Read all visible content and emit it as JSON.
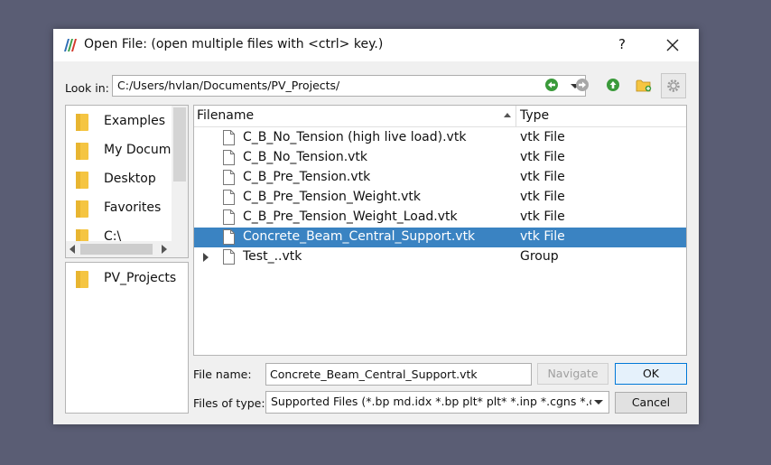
{
  "window": {
    "title": "Open File:  (open multiple files with <ctrl> key.)",
    "help_label": "?",
    "close_icon": "close-icon"
  },
  "look_in": {
    "label": "Look in:",
    "value": "C:/Users/hvlan/Documents/PV_Projects/"
  },
  "nav_icons": [
    "back-arrow-icon",
    "forward-arrow-icon",
    "up-arrow-icon",
    "new-folder-icon",
    "settings-gear-icon"
  ],
  "sidebar": {
    "favorites": [
      {
        "label": "Examples"
      },
      {
        "label": "My Docume"
      },
      {
        "label": "Desktop"
      },
      {
        "label": "Favorites"
      },
      {
        "label": "C:\\"
      }
    ],
    "recent": [
      {
        "label": "PV_Projects"
      }
    ]
  },
  "file_list": {
    "columns": {
      "name": "Filename",
      "type": "Type"
    },
    "rows": [
      {
        "name": "C_B_No_Tension (high live load).vtk",
        "type": "vtk File",
        "selected": false,
        "expandable": false
      },
      {
        "name": "C_B_No_Tension.vtk",
        "type": "vtk File",
        "selected": false,
        "expandable": false
      },
      {
        "name": "C_B_Pre_Tension.vtk",
        "type": "vtk File",
        "selected": false,
        "expandable": false
      },
      {
        "name": "C_B_Pre_Tension_Weight.vtk",
        "type": "vtk File",
        "selected": false,
        "expandable": false
      },
      {
        "name": "C_B_Pre_Tension_Weight_Load.vtk",
        "type": "vtk File",
        "selected": false,
        "expandable": false
      },
      {
        "name": "Concrete_Beam_Central_Support.vtk",
        "type": "vtk File",
        "selected": true,
        "expandable": false
      },
      {
        "name": "Test_..vtk",
        "type": "Group",
        "selected": false,
        "expandable": true
      }
    ]
  },
  "file_name": {
    "label": "File name:",
    "value": "Concrete_Beam_Central_Support.vtk"
  },
  "files_of_type": {
    "label": "Files of type:",
    "value": "Supported Files (*.bp md.idx *.bp plt* plt* *.inp *.cgns *.cr"
  },
  "buttons": {
    "navigate": "Navigate",
    "ok": "OK",
    "cancel": "Cancel"
  },
  "colors": {
    "selection": "#3a83c2",
    "folder": "#f5c542",
    "nav_green": "#3a9a3a"
  }
}
